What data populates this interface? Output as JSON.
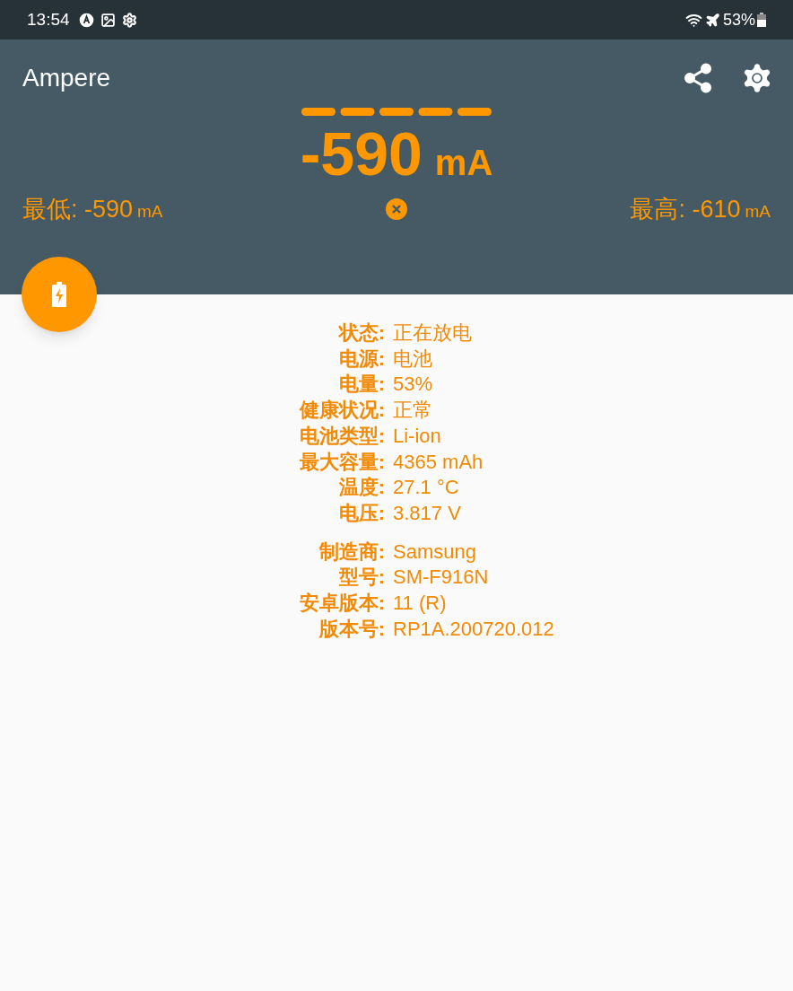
{
  "status_bar": {
    "time": "13:54",
    "battery": "53%"
  },
  "app_bar": {
    "title": "Ampere"
  },
  "reading": {
    "value": "-590",
    "unit": "mA"
  },
  "min": {
    "text": "最低: -590",
    "unit": "mA"
  },
  "max": {
    "text": "最高: -610",
    "unit": "mA"
  },
  "info_groups": [
    [
      {
        "label": "状态:",
        "value": "正在放电"
      },
      {
        "label": "电源:",
        "value": "电池"
      },
      {
        "label": "电量:",
        "value": "53%"
      },
      {
        "label": "健康状况:",
        "value": "正常"
      },
      {
        "label": "电池类型:",
        "value": "Li-ion"
      },
      {
        "label": "最大容量:",
        "value": "4365 mAh"
      },
      {
        "label": "温度:",
        "value": "27.1 °C"
      },
      {
        "label": "电压:",
        "value": "3.817 V"
      }
    ],
    [
      {
        "label": "制造商:",
        "value": "Samsung"
      },
      {
        "label": "型号:",
        "value": "SM-F916N"
      },
      {
        "label": "安卓版本:",
        "value": "11 (R)"
      },
      {
        "label": "版本号:",
        "value": "RP1A.200720.012"
      }
    ]
  ]
}
